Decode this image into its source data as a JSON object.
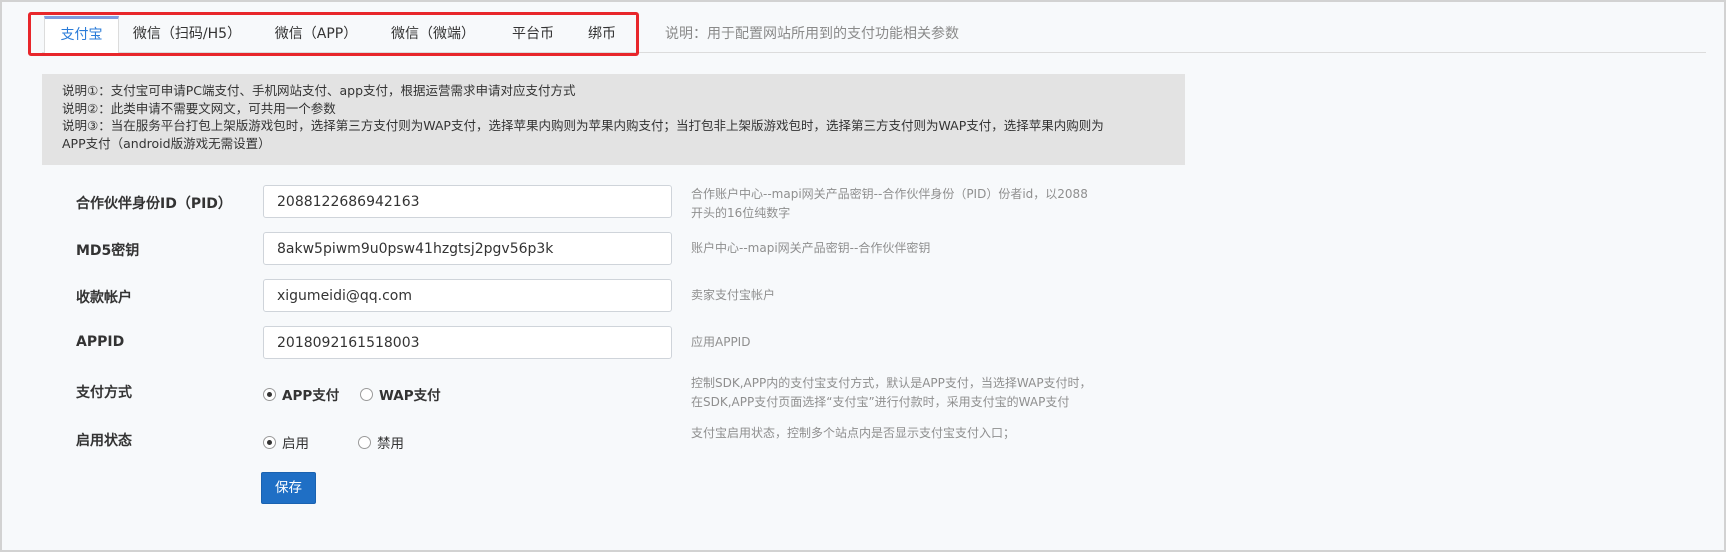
{
  "tabs": [
    {
      "label": "支付宝",
      "active": true
    },
    {
      "label": "微信（扫码/H5）"
    },
    {
      "label": "微信（APP）"
    },
    {
      "label": "微信（微端）"
    },
    {
      "label": "平台币"
    },
    {
      "label": "绑币"
    }
  ],
  "tab_note": "说明：用于配置网站所用到的支付功能相关参数",
  "notice": [
    "说明①：支付宝可申请PC端支付、手机网站支付、app支付，根据运营需求申请对应支付方式",
    "说明②：此类申请不需要文网文，可共用一个参数",
    "说明③：当在服务平台打包上架版游戏包时，选择第三方支付则为WAP支付，选择苹果内购则为苹果内购支付；当打包非上架版游戏包时，选择第三方支付则为WAP支付，选择苹果内购则为",
    "APP支付（android版游戏无需设置）"
  ],
  "form": {
    "pid": {
      "label": "合作伙伴身份ID（PID）",
      "value": "2088122686942163",
      "hint_line1": "合作账户中心--mapi网关产品密钥--合作伙伴身份（PID）份者id，以2088",
      "hint_line2": "开头的16位纯数字"
    },
    "md5": {
      "label": "MD5密钥",
      "value": "8akw5piwm9u0psw41hzgtsj2pgv56p3k",
      "hint": "账户中心--mapi网关产品密钥--合作伙伴密钥"
    },
    "account": {
      "label": "收款帐户",
      "value": "xigumeidi@qq.com",
      "hint": "卖家支付宝帐户"
    },
    "appid": {
      "label": "APPID",
      "value": "2018092161518003",
      "hint": "应用APPID"
    },
    "pay_method": {
      "label": "支付方式",
      "options": [
        "APP支付",
        "WAP支付"
      ],
      "selected": "APP支付",
      "hint_line1": "控制SDK,APP内的支付宝支付方式，默认是APP支付，当选择WAP支付时，",
      "hint_line2": "在SDK,APP支付页面选择“支付宝”进行付款时，采用支付宝的WAP支付"
    },
    "status": {
      "label": "启用状态",
      "options": [
        "启用",
        "禁用"
      ],
      "selected": "启用",
      "hint": "支付宝启用状态，控制多个站点内是否显示支付宝支付入口；"
    }
  },
  "save_label": "保存"
}
